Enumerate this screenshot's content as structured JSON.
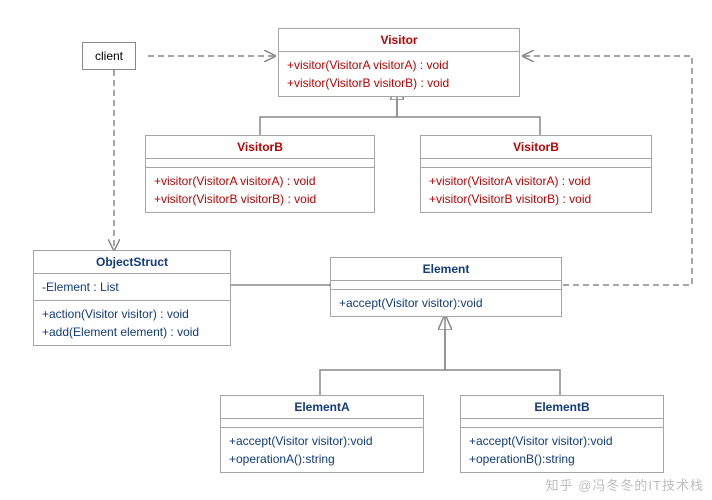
{
  "diagram": {
    "client": {
      "label": "client"
    },
    "visitor": {
      "title": "Visitor",
      "method1": "+visitor(VisitorA visitorA) : void",
      "method2": "+visitor(VisitorB visitorB) : void"
    },
    "visitorB1": {
      "title": "VisitorB",
      "method1": "+visitor(VisitorA visitorA) : void",
      "method2": "+visitor(VisitorB visitorB) : void"
    },
    "visitorB2": {
      "title": "VisitorB",
      "method1": "+visitor(VisitorA visitorA) : void",
      "method2": "+visitor(VisitorB visitorB) : void"
    },
    "objectStruct": {
      "title": "ObjectStruct",
      "attr1": "-Element : List",
      "method1": "+action(Visitor visitor) : void",
      "method2": "+add(Element element) : void"
    },
    "element": {
      "title": "Element",
      "method1": "+accept(Visitor visitor):void"
    },
    "elementA": {
      "title": "ElementA",
      "method1": "+accept(Visitor visitor):void",
      "method2": "+operationA():string"
    },
    "elementB": {
      "title": "ElementB",
      "method1": "+accept(Visitor visitor):void",
      "method2": "+operationB():string"
    },
    "watermark": "知乎 @冯冬冬的IT技术栈"
  }
}
